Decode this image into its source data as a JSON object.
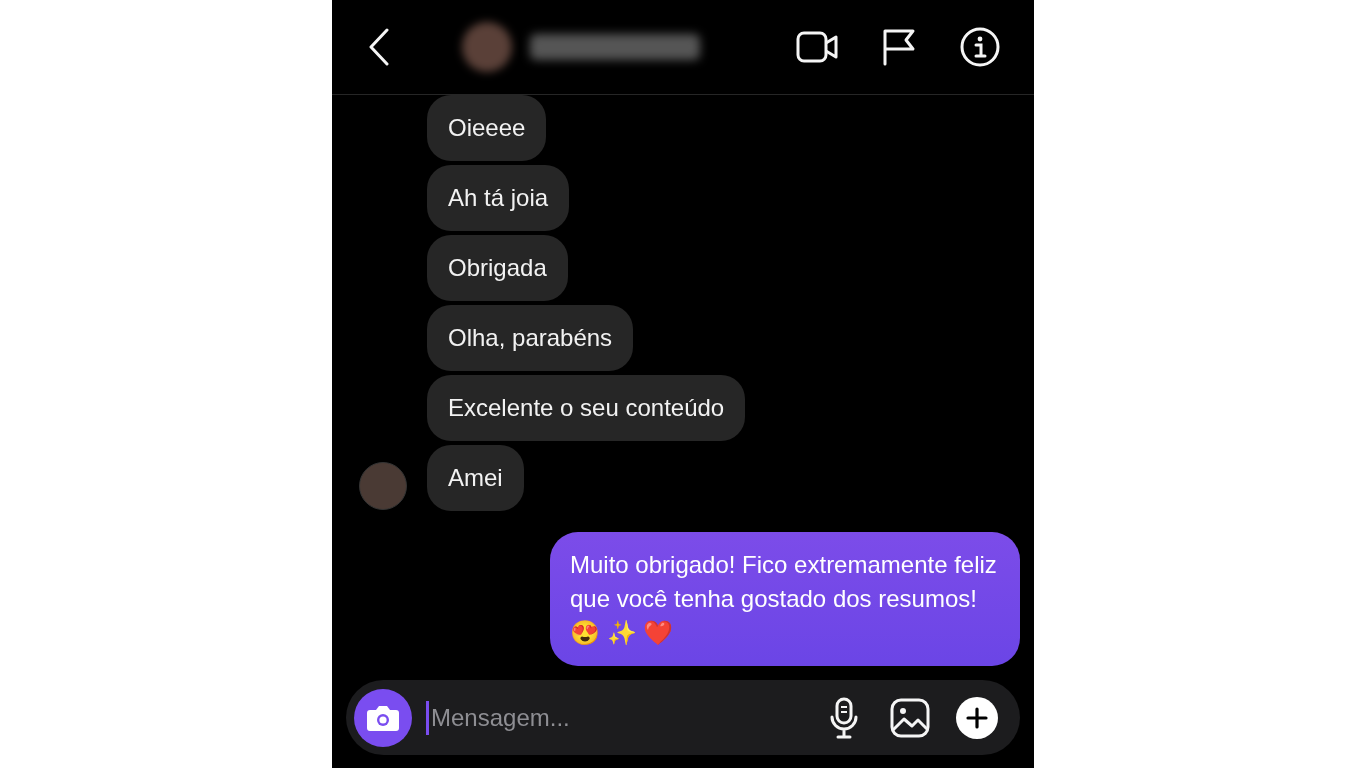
{
  "messages": [
    {
      "kind": "received",
      "text": "Oieeee"
    },
    {
      "kind": "received",
      "text": "Ah tá joia"
    },
    {
      "kind": "received",
      "text": "Obrigada"
    },
    {
      "kind": "received",
      "text": "Olha, parabéns"
    },
    {
      "kind": "received",
      "text": "Excelente o seu conteúdo"
    },
    {
      "kind": "received",
      "text": "Amei"
    },
    {
      "kind": "sent",
      "text": "Muito obrigado! Fico extremamente feliz que você tenha gostado dos resumos! 😍 ✨ ❤️"
    }
  ],
  "composer": {
    "placeholder": "Mensagem..."
  }
}
